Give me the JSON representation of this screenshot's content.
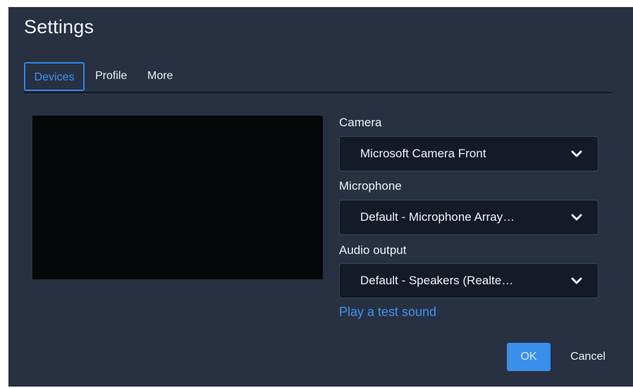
{
  "dialog": {
    "title": "Settings"
  },
  "tabs": [
    {
      "label": "Devices",
      "active": true
    },
    {
      "label": "Profile",
      "active": false
    },
    {
      "label": "More",
      "active": false
    }
  ],
  "devices": {
    "camera": {
      "label": "Camera",
      "value": "Microsoft Camera Front"
    },
    "microphone": {
      "label": "Microphone",
      "value": "Default - Microphone Array…"
    },
    "audio_output": {
      "label": "Audio output",
      "value": "Default - Speakers (Realte…"
    },
    "test_sound_link": "Play a test sound"
  },
  "footer": {
    "ok_label": "OK",
    "cancel_label": "Cancel"
  },
  "icons": {
    "dropdown": "chevron-down-icon"
  },
  "colors": {
    "dialog_background": "#283142",
    "accent": "#3a8fea",
    "select_background": "#141a26",
    "preview_background": "#050709"
  }
}
